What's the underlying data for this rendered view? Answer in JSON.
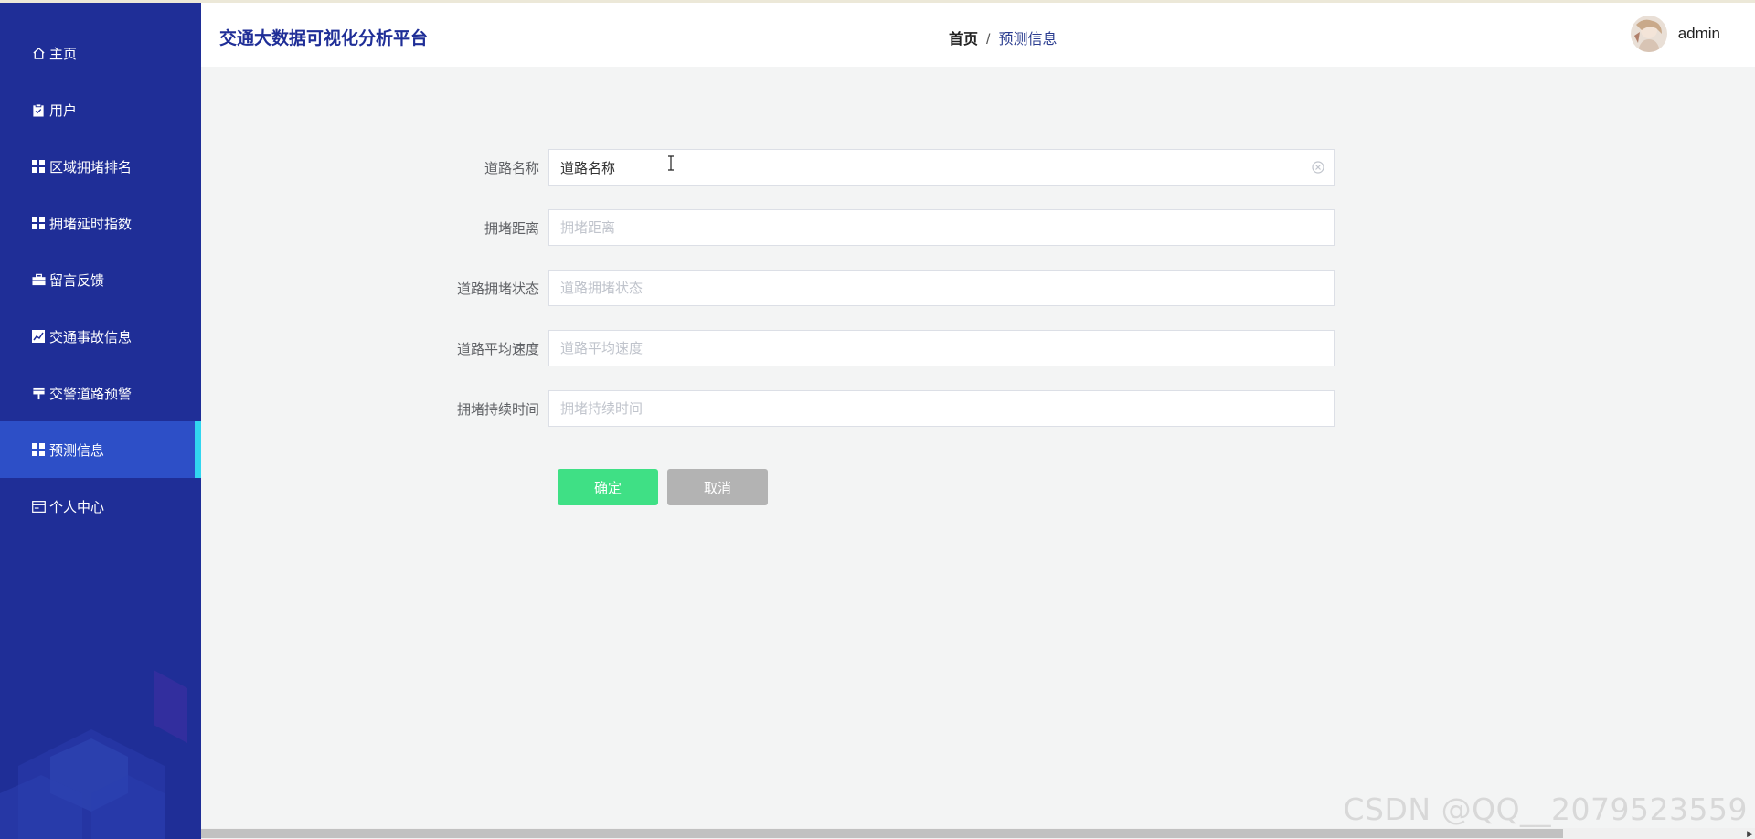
{
  "app": {
    "title": "交通大数据可视化分析平台"
  },
  "breadcrumb": {
    "home": "首页",
    "separator": "/",
    "current": "预测信息"
  },
  "user": {
    "name": "admin"
  },
  "sidebar": {
    "items": [
      {
        "label": "主页",
        "icon": "home-icon"
      },
      {
        "label": "用户",
        "icon": "clipboard-icon"
      },
      {
        "label": "区域拥堵排名",
        "icon": "grid-icon"
      },
      {
        "label": "拥堵延时指数",
        "icon": "grid-icon"
      },
      {
        "label": "留言反馈",
        "icon": "briefcase-icon"
      },
      {
        "label": "交通事故信息",
        "icon": "chart-icon"
      },
      {
        "label": "交警道路预警",
        "icon": "sign-icon"
      },
      {
        "label": "预测信息",
        "icon": "grid-icon",
        "active": true
      },
      {
        "label": "个人中心",
        "icon": "card-icon"
      }
    ]
  },
  "form": {
    "fields": [
      {
        "label": "道路名称",
        "value": "道路名称",
        "placeholder": "道路名称"
      },
      {
        "label": "拥堵距离",
        "value": "",
        "placeholder": "拥堵距离"
      },
      {
        "label": "道路拥堵状态",
        "value": "",
        "placeholder": "道路拥堵状态"
      },
      {
        "label": "道路平均速度",
        "value": "",
        "placeholder": "道路平均速度"
      },
      {
        "label": "拥堵持续时间",
        "value": "",
        "placeholder": "拥堵持续时间"
      }
    ],
    "submit_label": "确定",
    "cancel_label": "取消"
  },
  "watermark": "CSDN @QQ__2079523559",
  "colors": {
    "sidebar": "#1f2e97",
    "sidebar_active": "#2d4fc7",
    "active_indicator": "#31d6f0",
    "submit": "#3fe085",
    "cancel": "#b3b3b3"
  }
}
